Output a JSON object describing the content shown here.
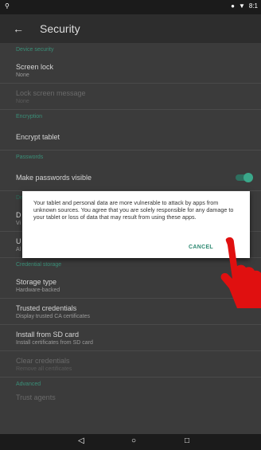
{
  "status": {
    "time": "8:1"
  },
  "appbar": {
    "title": "Security"
  },
  "sections": {
    "device_security": "Device security",
    "encryption": "Encryption",
    "passwords": "Passwords",
    "credential_storage": "Credential storage",
    "advanced": "Advanced"
  },
  "items": {
    "screen_lock": {
      "title": "Screen lock",
      "subtitle": "None"
    },
    "lock_screen_message": {
      "title": "Lock screen message",
      "subtitle": "None"
    },
    "encrypt_tablet": {
      "title": "Encrypt tablet"
    },
    "make_passwords_visible": {
      "title": "Make passwords visible",
      "enabled": true
    },
    "device_admin_partial": {
      "title": "D",
      "subtitle": "Vi"
    },
    "unknown_sources_partial": {
      "title": "U",
      "subtitle": "Al"
    },
    "storage_type": {
      "title": "Storage type",
      "subtitle": "Hardware-backed"
    },
    "trusted_credentials": {
      "title": "Trusted credentials",
      "subtitle": "Display trusted CA certificates"
    },
    "install_from_sd": {
      "title": "Install from SD card",
      "subtitle": "Install certificates from SD card"
    },
    "clear_credentials": {
      "title": "Clear credentials",
      "subtitle": "Remove all certificates"
    },
    "trust_agents": {
      "title": "Trust agents"
    }
  },
  "dialog": {
    "message": "Your tablet and personal data are more vulnerable to attack by apps from unknown sources. You agree that you are solely responsible for any damage to your tablet or loss of data that may result from using these apps.",
    "cancel_label": "CANCEL"
  },
  "colors": {
    "accent": "#2f8a73",
    "background": "#3b3b3b",
    "hand": "#e01010"
  },
  "icons": {
    "back": "back-arrow-icon",
    "nav_back": "triangle-back-icon",
    "nav_home": "circle-home-icon",
    "nav_recents": "square-recents-icon"
  }
}
